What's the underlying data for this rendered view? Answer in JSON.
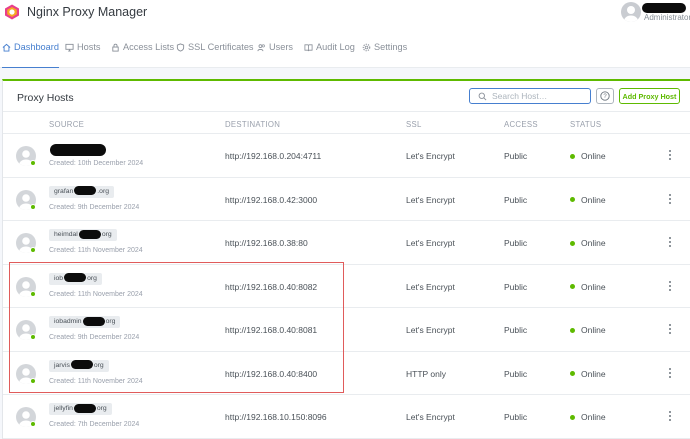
{
  "header": {
    "brand": "Nginx Proxy Manager",
    "user_role": "Administrator",
    "logo_color": "#e83e8c"
  },
  "nav": [
    {
      "label": "Dashboard",
      "icon": "home-icon",
      "active": true
    },
    {
      "label": "Hosts",
      "icon": "monitor-icon"
    },
    {
      "label": "Access Lists",
      "icon": "lock-icon"
    },
    {
      "label": "SSL Certificates",
      "icon": "shield-icon"
    },
    {
      "label": "Users",
      "icon": "users-icon"
    },
    {
      "label": "Audit Log",
      "icon": "book-icon"
    },
    {
      "label": "Settings",
      "icon": "gear-icon"
    }
  ],
  "card": {
    "title": "Proxy Hosts",
    "search_placeholder": "Search Host…",
    "help_label": "?",
    "add_label": "Add Proxy Host",
    "accent": "#5eba00"
  },
  "columns": {
    "source": "SOURCE",
    "destination": "DESTINATION",
    "ssl": "SSL",
    "access": "ACCESS",
    "status": "STATUS"
  },
  "rows": [
    {
      "prefix": "",
      "suffix": "",
      "created": "Created: 10th December 2024",
      "destination": "http://192.168.0.204:4711",
      "ssl": "Let's Encrypt",
      "access": "Public",
      "status": "Online"
    },
    {
      "prefix": "grafan",
      "suffix": ".org",
      "created": "Created: 9th December 2024",
      "destination": "http://192.168.0.42:3000",
      "ssl": "Let's Encrypt",
      "access": "Public",
      "status": "Online"
    },
    {
      "prefix": "heimdal",
      "suffix": "org",
      "created": "Created: 11th November 2024",
      "destination": "http://192.168.0.38:80",
      "ssl": "Let's Encrypt",
      "access": "Public",
      "status": "Online"
    },
    {
      "prefix": "iob",
      "suffix": "org",
      "created": "Created: 11th November 2024",
      "destination": "http://192.168.0.40:8082",
      "ssl": "Let's Encrypt",
      "access": "Public",
      "status": "Online"
    },
    {
      "prefix": "iobadmin",
      "suffix": "org",
      "created": "Created: 9th December 2024",
      "destination": "http://192.168.0.40:8081",
      "ssl": "Let's Encrypt",
      "access": "Public",
      "status": "Online"
    },
    {
      "prefix": "jarvis",
      "suffix": "org",
      "created": "Created: 11th November 2024",
      "destination": "http://192.168.0.40:8400",
      "ssl": "HTTP only",
      "access": "Public",
      "status": "Online"
    },
    {
      "prefix": "jellyfin",
      "suffix": "org",
      "created": "Created: 7th December 2024",
      "destination": "http://192.168.10.150:8096",
      "ssl": "Let's Encrypt",
      "access": "Public",
      "status": "Online"
    }
  ]
}
